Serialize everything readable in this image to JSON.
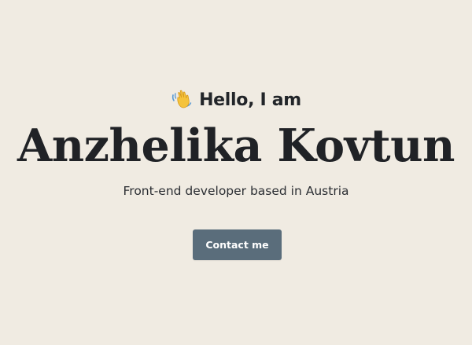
{
  "hero": {
    "greeting": "Hello, I am",
    "greeting_icon": "waving-hand-icon",
    "name": "Anzhelika Kovtun",
    "tagline": "Front-end developer based in Austria",
    "contact_label": "Contact me"
  },
  "colors": {
    "background": "#f0ebe2",
    "text": "#202226",
    "button": "#5a6d7b",
    "button_text": "#ffffff",
    "wave_hand": "#f5c33b"
  }
}
